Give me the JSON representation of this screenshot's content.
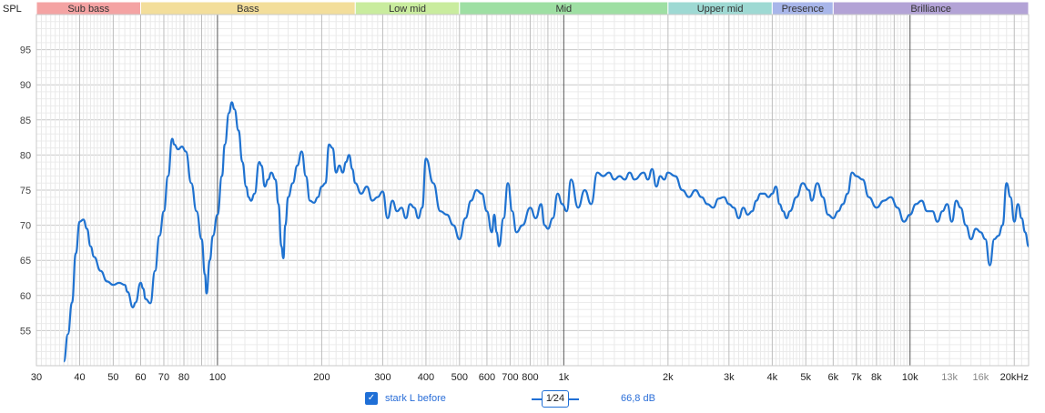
{
  "chart_data": {
    "type": "line",
    "ylabel": "SPL",
    "x_scale": "log",
    "xlim": [
      30,
      22000
    ],
    "ylim": [
      50,
      100
    ],
    "grid": true,
    "y_ticks": [
      55,
      60,
      65,
      70,
      75,
      80,
      85,
      90,
      95
    ],
    "x_ticks": [
      {
        "value": 30,
        "label": "30"
      },
      {
        "value": 40,
        "label": "40"
      },
      {
        "value": 50,
        "label": "50"
      },
      {
        "value": 60,
        "label": "60"
      },
      {
        "value": 70,
        "label": "70"
      },
      {
        "value": 80,
        "label": "80"
      },
      {
        "value": 100,
        "label": "100"
      },
      {
        "value": 200,
        "label": "200"
      },
      {
        "value": 300,
        "label": "300"
      },
      {
        "value": 400,
        "label": "400"
      },
      {
        "value": 500,
        "label": "500"
      },
      {
        "value": 600,
        "label": "600"
      },
      {
        "value": 700,
        "label": "700"
      },
      {
        "value": 800,
        "label": "800"
      },
      {
        "value": 1000,
        "label": "1k"
      },
      {
        "value": 2000,
        "label": "2k"
      },
      {
        "value": 3000,
        "label": "3k"
      },
      {
        "value": 4000,
        "label": "4k"
      },
      {
        "value": 5000,
        "label": "5k"
      },
      {
        "value": 6000,
        "label": "6k"
      },
      {
        "value": 7000,
        "label": "7k"
      },
      {
        "value": 8000,
        "label": "8k"
      },
      {
        "value": 10000,
        "label": "10k"
      },
      {
        "value": 13000,
        "label": "13k"
      },
      {
        "value": 16000,
        "label": "16k"
      },
      {
        "value": 20000,
        "label": "20kHz"
      }
    ],
    "bands": [
      {
        "name": "Sub bass",
        "from": 20,
        "to": 60,
        "color": "#f4a3a3"
      },
      {
        "name": "Bass",
        "from": 60,
        "to": 250,
        "color": "#f3de9b"
      },
      {
        "name": "Low mid",
        "from": 250,
        "to": 500,
        "color": "#c9ec9e"
      },
      {
        "name": "Mid",
        "from": 500,
        "to": 2000,
        "color": "#9edfa3"
      },
      {
        "name": "Upper mid",
        "from": 2000,
        "to": 4000,
        "color": "#9ed9d3"
      },
      {
        "name": "Presence",
        "from": 4000,
        "to": 6000,
        "color": "#a8b6ea"
      },
      {
        "name": "Brilliance",
        "from": 6000,
        "to": 22000,
        "color": "#b3a3d6"
      }
    ],
    "series": [
      {
        "name": "stark L before",
        "color": "#1f72d0",
        "points": [
          [
            36,
            50.6
          ],
          [
            37,
            54.5
          ],
          [
            38,
            59
          ],
          [
            39,
            66
          ],
          [
            40,
            70.5
          ],
          [
            41,
            70.8
          ],
          [
            42,
            69.5
          ],
          [
            43,
            67
          ],
          [
            44,
            65.5
          ],
          [
            46,
            63.5
          ],
          [
            48,
            62
          ],
          [
            50,
            61.5
          ],
          [
            52,
            61.8
          ],
          [
            54,
            61.5
          ],
          [
            55,
            60.5
          ],
          [
            57,
            58.3
          ],
          [
            58,
            59
          ],
          [
            60,
            61.8
          ],
          [
            61,
            61
          ],
          [
            62,
            59.5
          ],
          [
            64,
            58.9
          ],
          [
            66,
            63.5
          ],
          [
            68,
            68.5
          ],
          [
            70,
            72
          ],
          [
            72,
            77
          ],
          [
            74,
            82.3
          ],
          [
            75,
            81.5
          ],
          [
            77,
            80.8
          ],
          [
            79,
            81.2
          ],
          [
            81,
            80.5
          ],
          [
            84,
            76
          ],
          [
            87,
            72
          ],
          [
            90,
            68
          ],
          [
            92,
            63
          ],
          [
            93,
            60.3
          ],
          [
            95,
            65
          ],
          [
            97,
            68.5
          ],
          [
            100,
            71.5
          ],
          [
            103,
            77
          ],
          [
            105,
            81.5
          ],
          [
            108,
            86
          ],
          [
            110,
            87.5
          ],
          [
            112,
            86.5
          ],
          [
            115,
            83.5
          ],
          [
            118,
            79
          ],
          [
            121,
            75.5
          ],
          [
            123,
            74
          ],
          [
            125,
            73.5
          ],
          [
            128,
            74.5
          ],
          [
            132,
            79
          ],
          [
            134,
            78.5
          ],
          [
            137,
            75.5
          ],
          [
            140,
            76.5
          ],
          [
            143,
            77.5
          ],
          [
            147,
            76.5
          ],
          [
            150,
            73
          ],
          [
            153,
            67
          ],
          [
            155,
            65.3
          ],
          [
            157,
            70
          ],
          [
            160,
            74
          ],
          [
            165,
            76
          ],
          [
            170,
            78.5
          ],
          [
            175,
            80.5
          ],
          [
            180,
            77
          ],
          [
            185,
            73.5
          ],
          [
            190,
            73.2
          ],
          [
            195,
            74
          ],
          [
            200,
            75.5
          ],
          [
            205,
            76
          ],
          [
            210,
            81.5
          ],
          [
            215,
            81
          ],
          [
            220,
            77.5
          ],
          [
            225,
            78.5
          ],
          [
            230,
            77.5
          ],
          [
            235,
            79
          ],
          [
            240,
            80
          ],
          [
            245,
            78
          ],
          [
            250,
            76
          ],
          [
            260,
            74.5
          ],
          [
            270,
            75.5
          ],
          [
            280,
            73.5
          ],
          [
            290,
            74
          ],
          [
            300,
            74.8
          ],
          [
            310,
            71
          ],
          [
            320,
            73.5
          ],
          [
            330,
            72
          ],
          [
            340,
            72.5
          ],
          [
            350,
            71
          ],
          [
            360,
            73
          ],
          [
            370,
            72.5
          ],
          [
            380,
            71
          ],
          [
            390,
            72.5
          ],
          [
            400,
            79.5
          ],
          [
            420,
            76
          ],
          [
            440,
            72
          ],
          [
            460,
            71.5
          ],
          [
            480,
            70
          ],
          [
            500,
            68
          ],
          [
            520,
            71
          ],
          [
            540,
            73.5
          ],
          [
            560,
            75
          ],
          [
            580,
            74.5
          ],
          [
            600,
            72
          ],
          [
            620,
            69
          ],
          [
            630,
            71.5
          ],
          [
            640,
            69
          ],
          [
            650,
            67
          ],
          [
            670,
            71
          ],
          [
            690,
            76
          ],
          [
            710,
            72
          ],
          [
            730,
            69
          ],
          [
            760,
            70
          ],
          [
            800,
            72.5
          ],
          [
            830,
            71
          ],
          [
            860,
            73
          ],
          [
            880,
            70
          ],
          [
            900,
            69.5
          ],
          [
            930,
            71
          ],
          [
            960,
            74.5
          ],
          [
            990,
            73
          ],
          [
            1020,
            72
          ],
          [
            1050,
            76.5
          ],
          [
            1100,
            72.5
          ],
          [
            1150,
            75
          ],
          [
            1200,
            73
          ],
          [
            1250,
            77.5
          ],
          [
            1300,
            77
          ],
          [
            1350,
            77.5
          ],
          [
            1400,
            76.5
          ],
          [
            1450,
            77
          ],
          [
            1500,
            76.5
          ],
          [
            1550,
            77.5
          ],
          [
            1600,
            76.5
          ],
          [
            1700,
            77.5
          ],
          [
            1750,
            76.5
          ],
          [
            1800,
            78
          ],
          [
            1850,
            75.5
          ],
          [
            1900,
            77
          ],
          [
            1950,
            76.5
          ],
          [
            2000,
            77.5
          ],
          [
            2100,
            77
          ],
          [
            2200,
            75
          ],
          [
            2300,
            74
          ],
          [
            2400,
            75
          ],
          [
            2500,
            74
          ],
          [
            2600,
            73
          ],
          [
            2700,
            72.5
          ],
          [
            2800,
            73.8
          ],
          [
            2900,
            74
          ],
          [
            3000,
            73
          ],
          [
            3100,
            72.5
          ],
          [
            3200,
            71
          ],
          [
            3300,
            72.5
          ],
          [
            3400,
            71.5
          ],
          [
            3500,
            72
          ],
          [
            3600,
            73.5
          ],
          [
            3700,
            74.5
          ],
          [
            3800,
            74.5
          ],
          [
            3900,
            74
          ],
          [
            4000,
            74.5
          ],
          [
            4100,
            75.5
          ],
          [
            4200,
            73
          ],
          [
            4300,
            72
          ],
          [
            4400,
            71
          ],
          [
            4500,
            72
          ],
          [
            4700,
            74
          ],
          [
            4900,
            76
          ],
          [
            5100,
            75
          ],
          [
            5200,
            73.5
          ],
          [
            5400,
            76
          ],
          [
            5600,
            74
          ],
          [
            5800,
            71.5
          ],
          [
            6000,
            71
          ],
          [
            6200,
            72
          ],
          [
            6400,
            73
          ],
          [
            6600,
            74.5
          ],
          [
            6800,
            77.5
          ],
          [
            7000,
            77
          ],
          [
            7300,
            76.5
          ],
          [
            7600,
            74
          ],
          [
            8000,
            72.5
          ],
          [
            8400,
            73.5
          ],
          [
            8800,
            74
          ],
          [
            9200,
            72.5
          ],
          [
            9600,
            70.5
          ],
          [
            10000,
            71.5
          ],
          [
            10400,
            73
          ],
          [
            10800,
            73.5
          ],
          [
            11200,
            72
          ],
          [
            11600,
            72
          ],
          [
            12000,
            70.5
          ],
          [
            12400,
            72
          ],
          [
            12800,
            73
          ],
          [
            13200,
            70.5
          ],
          [
            13600,
            73.5
          ],
          [
            14000,
            72.5
          ],
          [
            14500,
            70
          ],
          [
            15000,
            68
          ],
          [
            15500,
            69.5
          ],
          [
            16000,
            69
          ],
          [
            16500,
            68
          ],
          [
            17000,
            64.3
          ],
          [
            17500,
            68
          ],
          [
            18000,
            68.5
          ],
          [
            18500,
            70
          ],
          [
            19000,
            76
          ],
          [
            19500,
            74
          ],
          [
            20000,
            70.5
          ],
          [
            20500,
            73
          ],
          [
            21000,
            71
          ],
          [
            21500,
            69
          ],
          [
            22000,
            67
          ]
        ]
      }
    ]
  },
  "footer": {
    "checkbox_mark": "✓",
    "legend_label": "stark L before",
    "smoothing_label": "1⁄24",
    "level_readout": "66,8 dB"
  }
}
